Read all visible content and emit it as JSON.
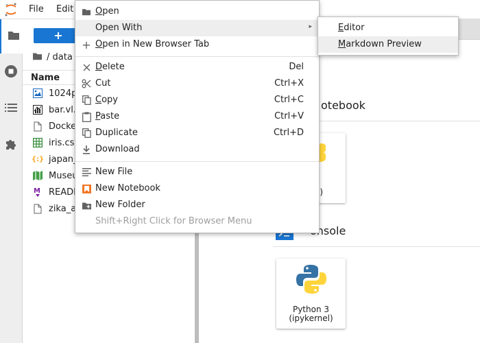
{
  "menubar": {
    "file": "File",
    "edit": "Edit"
  },
  "filebrowser": {
    "new_button": "+",
    "path": "/ data",
    "column_name": "Name",
    "files": [
      {
        "name": "1024p",
        "icon": "image-icon"
      },
      {
        "name": "bar.vl.",
        "icon": "vega-chart-icon"
      },
      {
        "name": "Docke",
        "icon": "file-icon"
      },
      {
        "name": "iris.csv",
        "icon": "spreadsheet-icon"
      },
      {
        "name": "japan_",
        "icon": "json-icon"
      },
      {
        "name": "Museu",
        "icon": "map-icon"
      },
      {
        "name": "READM",
        "icon": "markdown-icon"
      },
      {
        "name": "zika_a",
        "icon": "file-icon"
      }
    ]
  },
  "launcher": {
    "notebook_section": "otebook",
    "console_section": "onsole",
    "notebook_card": {
      "line1": "on 3",
      "line2": "ernel)"
    },
    "console_card": {
      "line1": "Python 3",
      "line2": "(ipykernel)"
    }
  },
  "context_menu": {
    "open": {
      "pre": "",
      "u": "O",
      "post": "pen"
    },
    "open_with": "Open With",
    "open_new_tab": {
      "pre": "",
      "u": "O",
      "post": "pen in New Browser Tab"
    },
    "delete": {
      "pre": "",
      "u": "D",
      "post": "elete",
      "key": "Del"
    },
    "cut": {
      "label": "Cut",
      "key": "Ctrl+X"
    },
    "copy": {
      "pre": "",
      "u": "C",
      "post": "opy",
      "key": "Ctrl+C"
    },
    "paste": {
      "pre": "",
      "u": "P",
      "post": "aste",
      "key": "Ctrl+V"
    },
    "duplicate": {
      "label": "Duplicate",
      "key": "Ctrl+D"
    },
    "download": "Download",
    "new_file": "New File",
    "new_notebook": "New Notebook",
    "new_folder": "New Folder",
    "browser_menu_hint": "Shift+Right Click for Browser Menu"
  },
  "submenu": {
    "editor": {
      "pre": "",
      "u": "E",
      "post": "ditor"
    },
    "markdown_preview": {
      "pre": "",
      "u": "M",
      "post": "arkdown Preview"
    }
  },
  "colors": {
    "accent": "#1976d2",
    "jupyter_orange": "#f37726",
    "python_blue": "#3572a5",
    "python_yellow": "#ffd43b"
  }
}
